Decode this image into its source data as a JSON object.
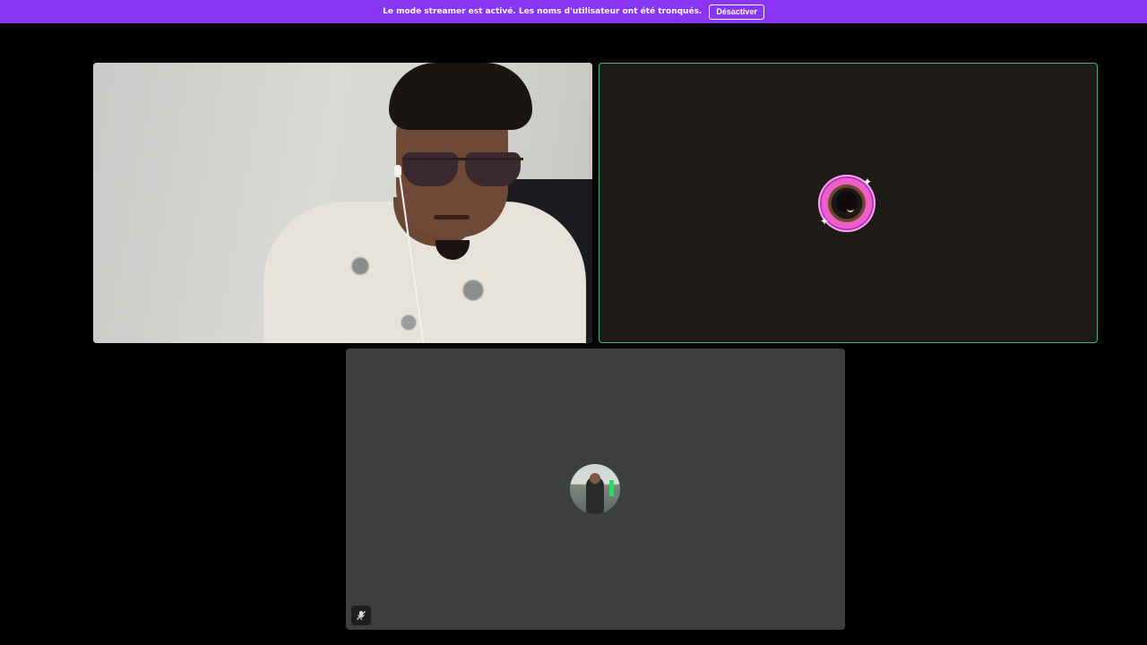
{
  "banner": {
    "message": "Le mode streamer est activé. Les noms d'utilisateur ont été tronqués.",
    "button_label": "Désactiver",
    "background": "#8a34f5"
  },
  "call": {
    "tiles": [
      {
        "kind": "video",
        "speaking": false
      },
      {
        "kind": "avatar",
        "speaking": true,
        "speaking_border": "#43b581"
      },
      {
        "kind": "avatar",
        "speaking": false,
        "muted": true,
        "status_icon": "mic-off-icon"
      }
    ]
  }
}
